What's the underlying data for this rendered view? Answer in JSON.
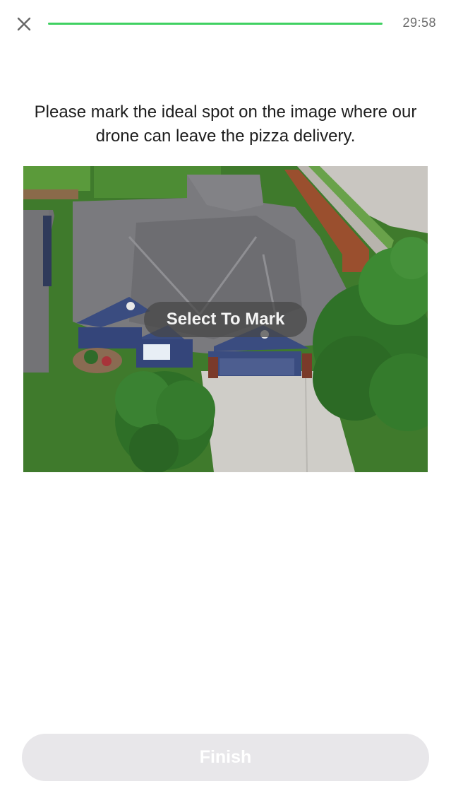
{
  "header": {
    "close_icon": "close-icon",
    "progress": 1.0,
    "progress_color": "#3fd161",
    "timer": "29:58"
  },
  "task": {
    "prompt": "Please mark the ideal spot on the image where our drone can leave the pizza delivery."
  },
  "image": {
    "overlay_label": "Select To Mark"
  },
  "footer": {
    "finish_label": "Finish",
    "finish_bg": "#e8e7ea"
  }
}
